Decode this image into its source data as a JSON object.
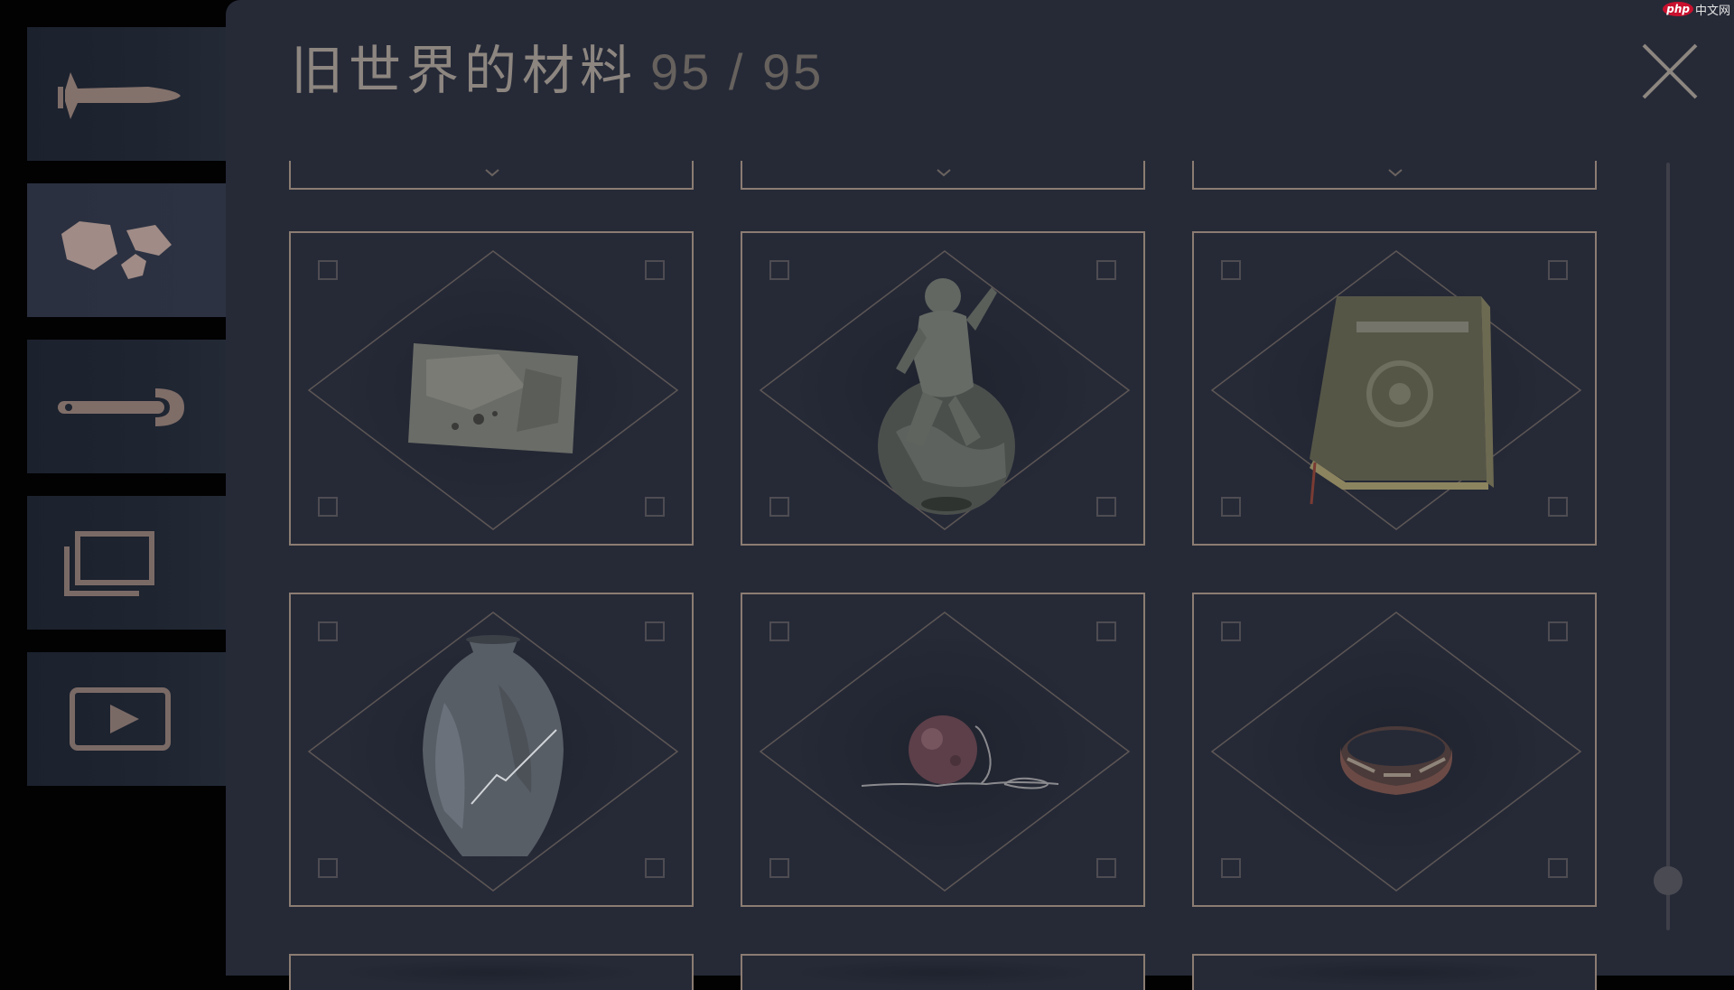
{
  "header": {
    "title": "旧世界的材料",
    "count": "95 / 95"
  },
  "sidebar": {
    "items": [
      {
        "id": "weapons",
        "icon": "missile-icon",
        "active": false
      },
      {
        "id": "materials",
        "icon": "rocks-icon",
        "active": true
      },
      {
        "id": "tools",
        "icon": "wrench-icon",
        "active": false
      },
      {
        "id": "gallery",
        "icon": "stacked-windows-icon",
        "active": false
      },
      {
        "id": "videos",
        "icon": "play-icon",
        "active": false
      }
    ]
  },
  "grid": {
    "items": [
      {
        "name": "stone-slab",
        "icon": "stone-slab-icon"
      },
      {
        "name": "globe-statue",
        "icon": "statue-on-globe-icon"
      },
      {
        "name": "old-book",
        "icon": "book-icon"
      },
      {
        "name": "cracked-vase",
        "icon": "vase-icon"
      },
      {
        "name": "pendant-orb",
        "icon": "orb-pendant-icon"
      },
      {
        "name": "bracelet",
        "icon": "bracelet-icon"
      }
    ]
  },
  "watermark": {
    "logo": "php",
    "text": "中文网"
  },
  "colors": {
    "panel_bg": "#262a37",
    "card_border": "#8b7c72",
    "title_text": "#8d8680",
    "count_text": "#66615d",
    "icon_tan": "#8a7670"
  }
}
